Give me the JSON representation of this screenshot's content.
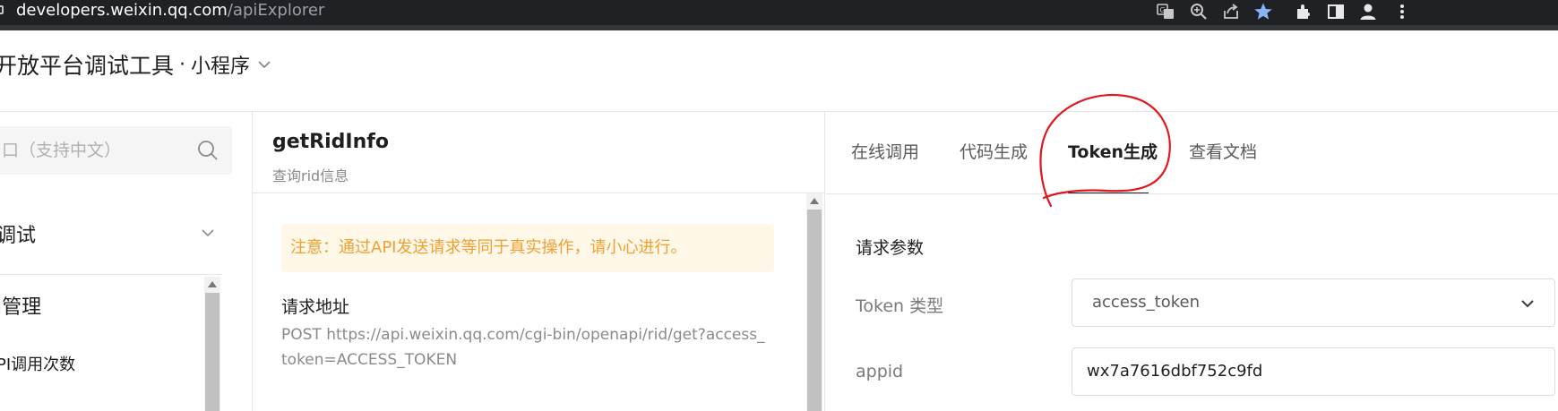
{
  "browser": {
    "url_host": "developers.weixin.qq.com",
    "url_path": "/apiExplorer",
    "icons": [
      "translate-icon",
      "zoom-icon",
      "share-icon",
      "bookmark-star-icon",
      "extensions-icon",
      "sidepanel-icon",
      "profile-icon",
      "menu-icon"
    ]
  },
  "header": {
    "title": "开放平台调试工具",
    "separator": "·",
    "product": "小程序"
  },
  "sidebar": {
    "search_placeholder": "口（支持中文）",
    "group_label": "调试",
    "item_label": "i管理",
    "sub_item_label": "PI调用次数"
  },
  "api": {
    "name": "getRidInfo",
    "description": "查询rid信息",
    "notice": "注意：通过API发送请求等同于真实操作，请小心进行。",
    "request_url_label": "请求地址",
    "request_url": "POST https://api.weixin.qq.com/cgi-bin/openapi/rid/get?access_token=ACCESS_TOKEN"
  },
  "tabs": [
    {
      "label": "在线调用",
      "active": false
    },
    {
      "label": "代码生成",
      "active": false
    },
    {
      "label": "Token生成",
      "active": true
    },
    {
      "label": "查看文档",
      "active": false
    }
  ],
  "params": {
    "section_title": "请求参数",
    "token_type_label": "Token 类型",
    "token_type_value": "access_token",
    "appid_label": "appid",
    "appid_value": "wx7a7616dbf752c9fd"
  },
  "colors": {
    "notice_bg": "#fff7e8",
    "notice_text": "#f0a030",
    "annotation": "#e0171d",
    "browser_bar": "#202124",
    "bookmark_star": "#8ab4f8"
  }
}
